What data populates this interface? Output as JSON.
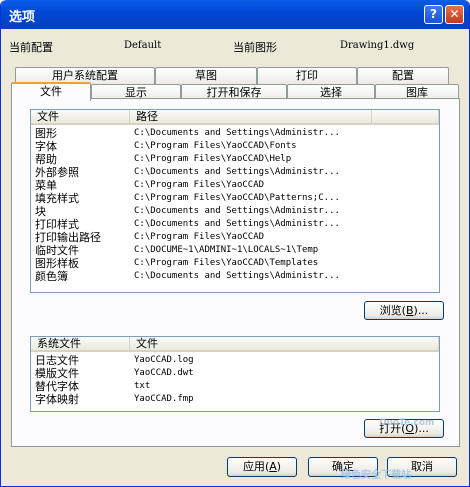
{
  "window": {
    "title": "选项",
    "help_glyph": "?",
    "close_glyph": "✕"
  },
  "config": {
    "current_config_label": "当前配置",
    "current_config_value": "Default",
    "current_drawing_label": "当前图形",
    "current_drawing_value": "Drawing1.dwg"
  },
  "tabs_back": [
    "用户系统配置",
    "草图",
    "打印",
    "配置"
  ],
  "tabs_front": [
    "文件",
    "显示",
    "打开和保存",
    "选择",
    "图库"
  ],
  "paths": {
    "col_file": "文件",
    "col_path": "路径",
    "rows": [
      {
        "file": "图形",
        "path": "C:\\Documents and Settings\\Administr..."
      },
      {
        "file": "字体",
        "path": "C:\\Program Files\\YaoCCAD\\Fonts"
      },
      {
        "file": "帮助",
        "path": "C:\\Program Files\\YaoCCAD\\Help"
      },
      {
        "file": "外部参照",
        "path": "C:\\Documents and Settings\\Administr..."
      },
      {
        "file": "菜单",
        "path": "C:\\Program Files\\YaoCCAD"
      },
      {
        "file": "填充样式",
        "path": "C:\\Program Files\\YaoCCAD\\Patterns;C..."
      },
      {
        "file": "块",
        "path": "C:\\Documents and Settings\\Administr..."
      },
      {
        "file": "打印样式",
        "path": "C:\\Documents and Settings\\Administr..."
      },
      {
        "file": "打印输出路径",
        "path": "C:\\Program Files\\YaoCCAD"
      },
      {
        "file": "临时文件",
        "path": "C:\\DOCUME~1\\ADMINI~1\\LOCALS~1\\Temp"
      },
      {
        "file": "图形样板",
        "path": "C:\\Program Files\\YaoCCAD\\Templates"
      },
      {
        "file": "颜色簿",
        "path": "C:\\Documents and Settings\\Administr..."
      }
    ]
  },
  "browse_button": {
    "label": "浏览",
    "key": "B",
    "suffix": "..."
  },
  "system_files": {
    "col_sys": "系统文件",
    "col_file": "文件",
    "rows": [
      {
        "name": "日志文件",
        "file": "YaoCCAD.log"
      },
      {
        "name": "模版文件",
        "file": "YaoCCAD.dwt"
      },
      {
        "name": "替代字体",
        "file": "txt"
      },
      {
        "name": "字体映射",
        "file": "YaoCCAD.fmp"
      }
    ]
  },
  "open_button": {
    "label": "打开",
    "key": "O",
    "suffix": "..."
  },
  "apply_button": {
    "label": "应用",
    "key": "A"
  },
  "ok_button": {
    "label": "确定"
  },
  "cancel_button": {
    "label": "取消"
  },
  "watermark": {
    "line1": "DuoTe.com",
    "line2": "绿色安全下载站"
  }
}
